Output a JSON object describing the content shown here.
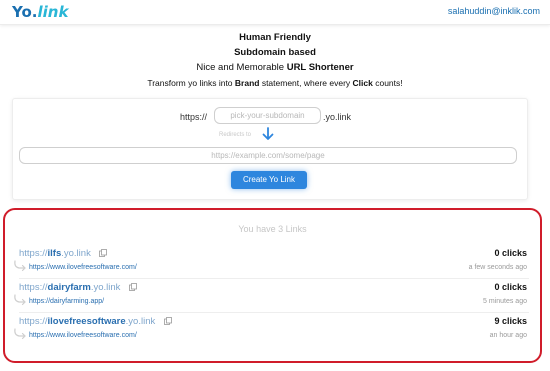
{
  "header": {
    "logo_yo": "Yo.",
    "logo_link": "link",
    "user_email": "salahuddin@inklik.com"
  },
  "hero": {
    "line1": "Human Friendly",
    "line2": "Subdomain based",
    "line3_prefix": "Nice and Memorable ",
    "line3_bold": "URL Shortener",
    "tagline_prefix": "Transform yo links into ",
    "tagline_bold1": "Brand",
    "tagline_mid": " statement, where every ",
    "tagline_bold2": "Click",
    "tagline_suffix": " counts!"
  },
  "create_form": {
    "url_prefix": "https://",
    "subdomain_placeholder": "pick-your-subdomain",
    "url_suffix": ".yo.link",
    "redirects_label": "Redirects to",
    "target_placeholder": "https://example.com/some/page",
    "create_button": "Create Yo Link"
  },
  "links_panel": {
    "header": "You have 3 Links",
    "links": [
      {
        "protocol": "https://",
        "slug": "ilfs",
        "domain": ".yo.link",
        "clicks": "0 clicks",
        "destination": "https://www.ilovefreesoftware.com/",
        "timestamp": "a few seconds ago"
      },
      {
        "protocol": "https://",
        "slug": "dairyfarm",
        "domain": ".yo.link",
        "clicks": "0 clicks",
        "destination": "https://dairyfarming.app/",
        "timestamp": "5 minutes ago"
      },
      {
        "protocol": "https://",
        "slug": "ilovefreesoftware",
        "domain": ".yo.link",
        "clicks": "9 clicks",
        "destination": "https://www.ilovefreesoftware.com/",
        "timestamp": "an hour ago"
      }
    ]
  },
  "colors": {
    "brand_blue": "#1a6fb0",
    "accent_cyan": "#29b6d6",
    "button_blue": "#2e86de",
    "highlight_red": "#d01c2a"
  }
}
